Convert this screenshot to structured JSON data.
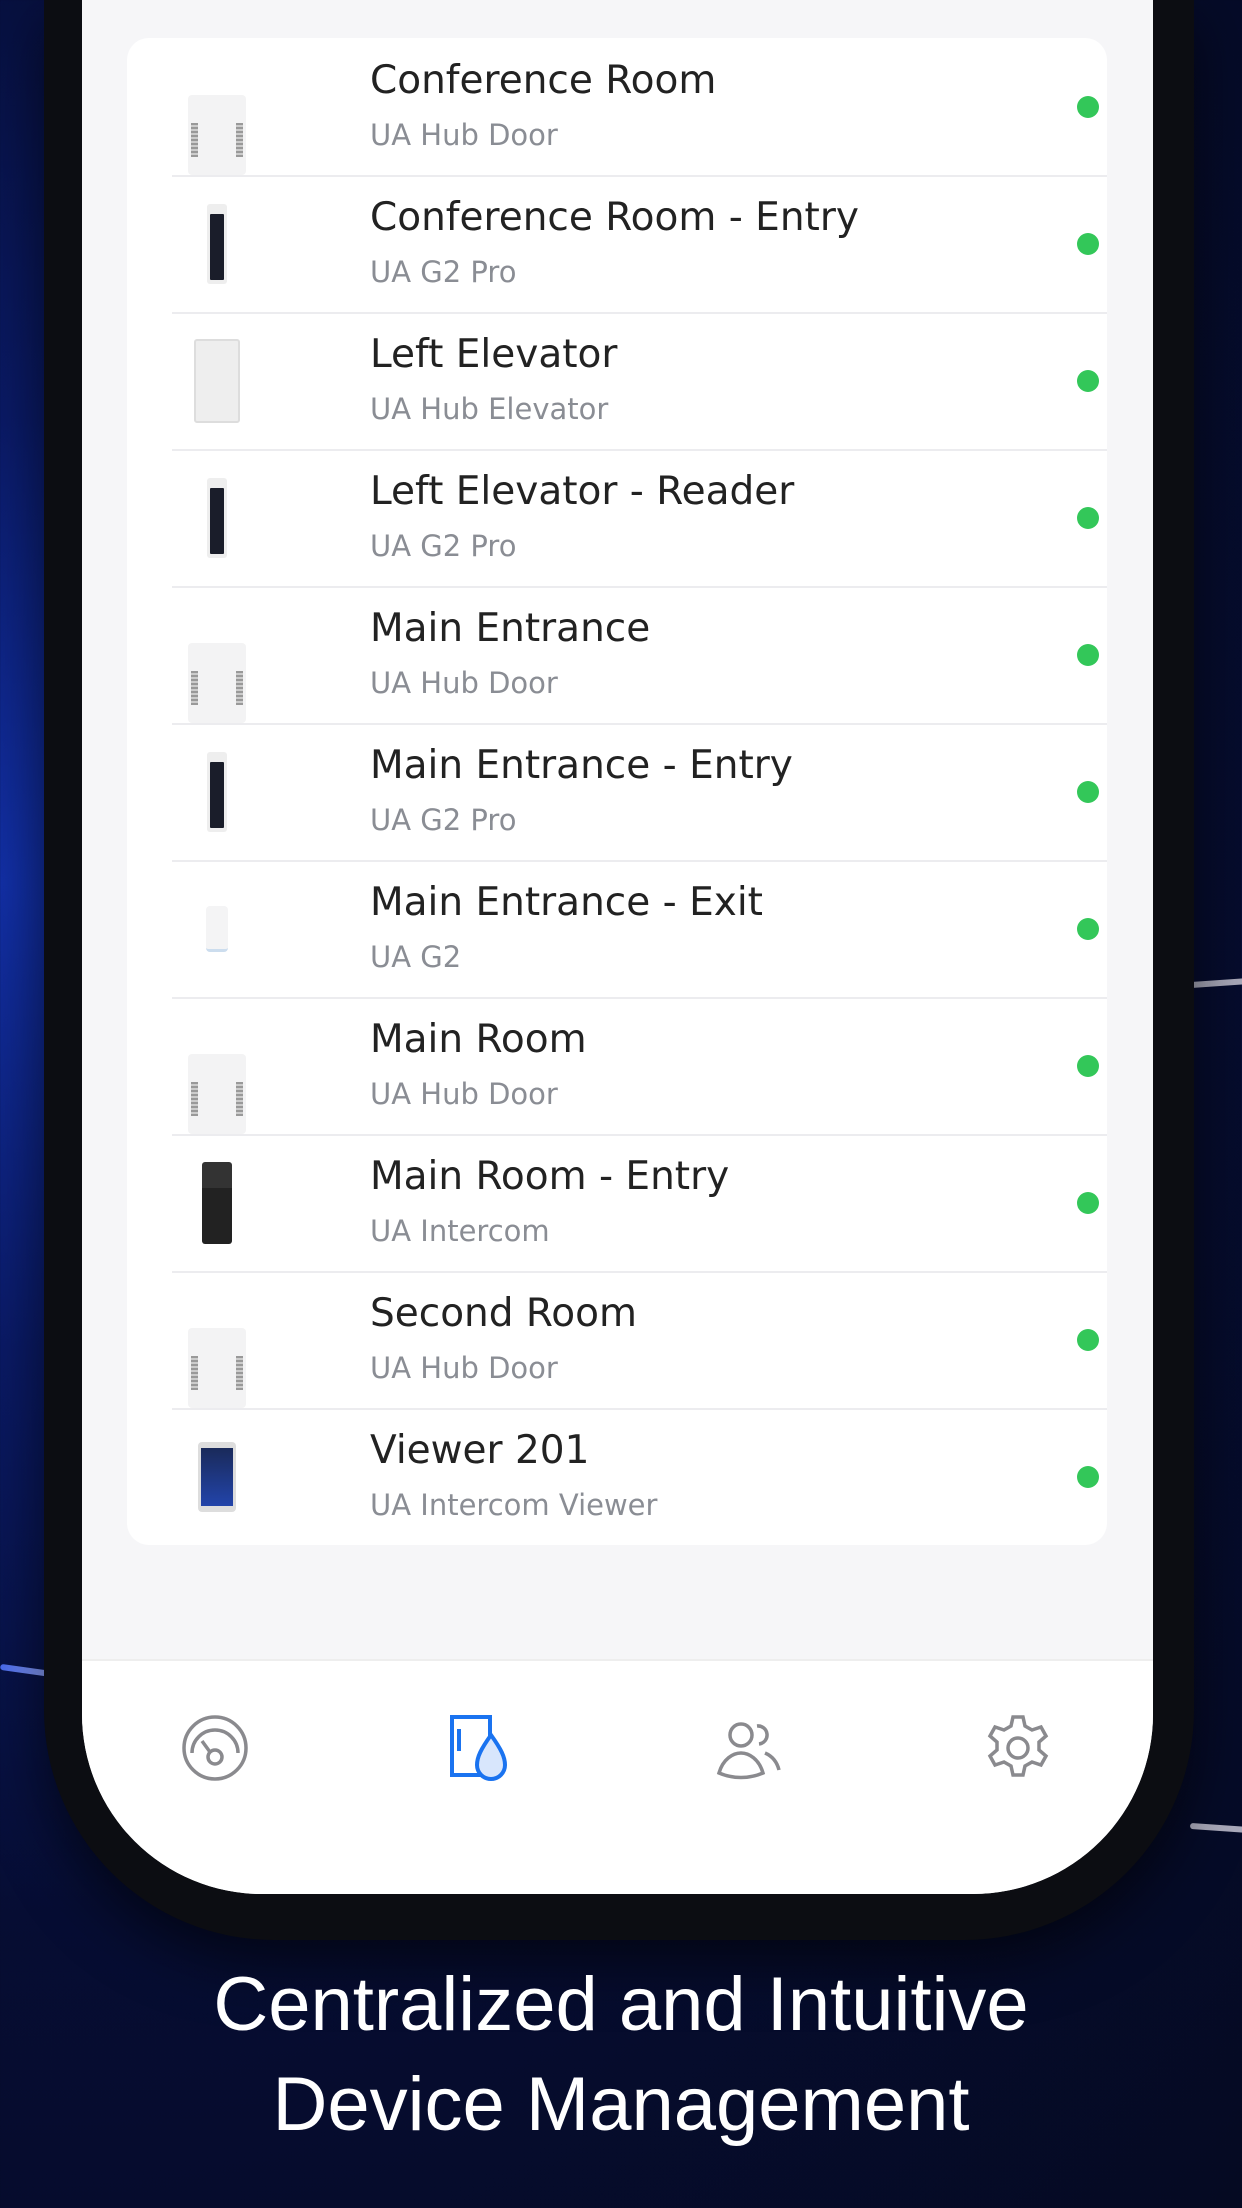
{
  "devices": [
    {
      "name": "Conference Room",
      "model": "UA Hub Door",
      "type": "hub",
      "status": "online"
    },
    {
      "name": "Conference Room - Entry",
      "model": "UA G2 Pro",
      "type": "g2pro",
      "status": "online"
    },
    {
      "name": "Left Elevator",
      "model": "UA Hub Elevator",
      "type": "hubel",
      "status": "online"
    },
    {
      "name": "Left Elevator - Reader",
      "model": "UA G2 Pro",
      "type": "g2pro",
      "status": "online"
    },
    {
      "name": "Main Entrance",
      "model": "UA Hub Door",
      "type": "hub",
      "status": "online"
    },
    {
      "name": "Main Entrance - Entry",
      "model": "UA G2 Pro",
      "type": "g2pro",
      "status": "online"
    },
    {
      "name": "Main Entrance - Exit",
      "model": "UA G2",
      "type": "g2",
      "status": "online"
    },
    {
      "name": "Main Room",
      "model": "UA Hub Door",
      "type": "hub",
      "status": "online"
    },
    {
      "name": "Main Room - Entry",
      "model": "UA Intercom",
      "type": "intercom",
      "status": "online"
    },
    {
      "name": "Second Room",
      "model": "UA Hub Door",
      "type": "hub",
      "status": "online"
    },
    {
      "name": "Viewer 201",
      "model": "UA Intercom Viewer",
      "type": "viewer",
      "status": "online"
    }
  ],
  "tabs": [
    {
      "icon": "dashboard-gauge-icon",
      "active": false
    },
    {
      "icon": "door-access-icon",
      "active": true
    },
    {
      "icon": "users-icon",
      "active": false
    },
    {
      "icon": "gear-icon",
      "active": false
    }
  ],
  "colors": {
    "online": "#33c759",
    "active_tab": "#1a73f0",
    "inactive_tab": "#8a8a8e"
  },
  "caption": {
    "line1": "Centralized and Intuitive",
    "line2": "Device Management"
  }
}
